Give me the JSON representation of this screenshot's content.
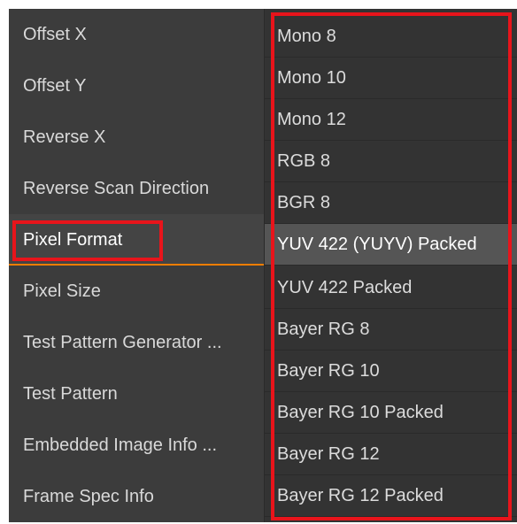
{
  "properties": [
    {
      "label": "Offset X"
    },
    {
      "label": "Offset Y"
    },
    {
      "label": "Reverse X"
    },
    {
      "label": "Reverse Scan Direction"
    },
    {
      "label": "Pixel Format"
    },
    {
      "label": "Pixel Size"
    },
    {
      "label": "Test Pattern Generator ..."
    },
    {
      "label": "Test Pattern"
    },
    {
      "label": "Embedded Image Info ..."
    },
    {
      "label": "Frame Spec Info"
    }
  ],
  "pixel_format_options": [
    {
      "label": "Mono 8"
    },
    {
      "label": "Mono 10"
    },
    {
      "label": "Mono 12"
    },
    {
      "label": "RGB 8"
    },
    {
      "label": "BGR 8"
    },
    {
      "label": "YUV 422 (YUYV) Packed"
    },
    {
      "label": "YUV 422 Packed"
    },
    {
      "label": "Bayer RG 8"
    },
    {
      "label": "Bayer RG 10"
    },
    {
      "label": "Bayer RG 10 Packed"
    },
    {
      "label": "Bayer RG 12"
    },
    {
      "label": "Bayer RG 12 Packed"
    }
  ],
  "selected_property": "Pixel Format",
  "selected_option": "YUV 422 (YUYV) Packed",
  "colors": {
    "panel_background": "#3c3c3c",
    "dropdown_background": "#333333",
    "selected_option_background": "#555555",
    "selection_underline": "#f07d00",
    "annotation_box": "#e8141b"
  }
}
